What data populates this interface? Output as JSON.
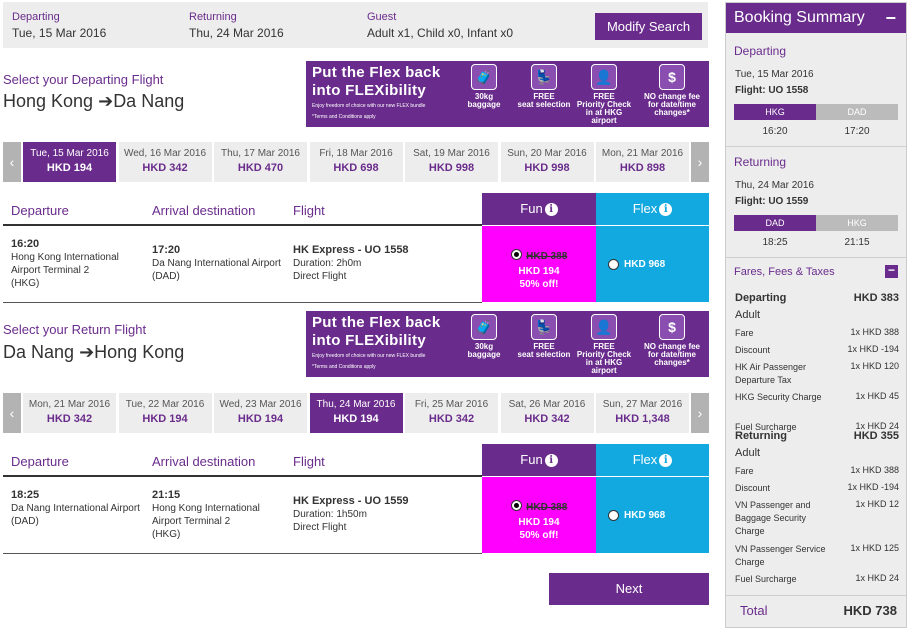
{
  "search": {
    "departing_label": "Departing",
    "departing_value": "Tue, 15 Mar 2016",
    "returning_label": "Returning",
    "returning_value": "Thu, 24 Mar 2016",
    "guest_label": "Guest",
    "guest_value": "Adult x1, Child x0, Infant x0",
    "modify_label": "Modify Search"
  },
  "banner": {
    "title_line1": "Put the Flex back",
    "title_line2": "into FLEXibility",
    "subtitle": "Enjoy freedom of choice with our new FLEX bundle",
    "terms": "*Terms and Conditions apply",
    "features": [
      {
        "icon": "baggage-icon",
        "glyph": "🧳",
        "line1": "30kg",
        "line2": "baggage"
      },
      {
        "icon": "seat-icon",
        "glyph": "💺",
        "line1": "FREE",
        "line2": "seat selection"
      },
      {
        "icon": "check-in-icon",
        "glyph": "👤",
        "line1": "FREE",
        "line2": "Priority Check in at HKG airport"
      },
      {
        "icon": "no-fee-icon",
        "glyph": "$",
        "line1": "NO change fee",
        "line2": "for date/time changes*"
      }
    ]
  },
  "outbound": {
    "select_title": "Select your Departing Flight",
    "route_from": "Hong Kong",
    "route_to": "Da Nang",
    "dates": [
      {
        "date": "Tue, 15 Mar 2016",
        "price": "HKD 194",
        "selected": true
      },
      {
        "date": "Wed, 16 Mar 2016",
        "price": "HKD 342",
        "selected": false
      },
      {
        "date": "Thu, 17 Mar 2016",
        "price": "HKD 470",
        "selected": false
      },
      {
        "date": "Fri, 18 Mar 2016",
        "price": "HKD 698",
        "selected": false
      },
      {
        "date": "Sat, 19 Mar 2016",
        "price": "HKD 998",
        "selected": false
      },
      {
        "date": "Sun, 20 Mar 2016",
        "price": "HKD 998",
        "selected": false
      },
      {
        "date": "Mon, 21 Mar 2016",
        "price": "HKD 898",
        "selected": false
      }
    ],
    "flight": {
      "dep_time": "16:20",
      "dep_airport": "Hong Kong International Airport Terminal 2",
      "dep_code": "(HKG)",
      "arr_time": "17:20",
      "arr_airport": "Da Nang International Airport",
      "arr_code": "(DAD)",
      "flight_no": "HK Express - UO 1558",
      "duration": "Duration: 2h0m",
      "type": "Direct Flight",
      "fun_old_price": "HKD 388",
      "fun_price": "HKD 194",
      "fun_discount": "50% off!",
      "flex_price": "HKD 968"
    }
  },
  "inbound": {
    "select_title": "Select your Return Flight",
    "route_from": "Da Nang",
    "route_to": "Hong Kong",
    "dates": [
      {
        "date": "Mon, 21 Mar 2016",
        "price": "HKD 342",
        "selected": false
      },
      {
        "date": "Tue, 22 Mar 2016",
        "price": "HKD 194",
        "selected": false
      },
      {
        "date": "Wed, 23 Mar 2016",
        "price": "HKD 194",
        "selected": false
      },
      {
        "date": "Thu, 24 Mar 2016",
        "price": "HKD 194",
        "selected": true
      },
      {
        "date": "Fri, 25 Mar 2016",
        "price": "HKD 342",
        "selected": false
      },
      {
        "date": "Sat, 26 Mar 2016",
        "price": "HKD 342",
        "selected": false
      },
      {
        "date": "Sun, 27 Mar 2016",
        "price": "HKD 1,348",
        "selected": false
      }
    ],
    "flight": {
      "dep_time": "18:25",
      "dep_airport": "Da Nang International Airport",
      "dep_code": "(DAD)",
      "arr_time": "21:15",
      "arr_airport": "Hong Kong International Airport Terminal 2",
      "arr_code": "(HKG)",
      "flight_no": "HK Express - UO 1559",
      "duration": "Duration: 1h50m",
      "type": "Direct Flight",
      "fun_old_price": "HKD 388",
      "fun_price": "HKD 194",
      "fun_discount": "50% off!",
      "flex_price": "HKD 968"
    }
  },
  "table_headers": {
    "departure": "Departure",
    "arrival": "Arrival destination",
    "flight": "Flight",
    "fun": "Fun",
    "flex": "Flex"
  },
  "next_label": "Next",
  "summary": {
    "title": "Booking Summary",
    "collapse": "−",
    "departing": {
      "label": "Departing",
      "date": "Tue, 15 Mar 2016",
      "flight": "Flight: UO 1558",
      "from": "HKG",
      "to": "DAD",
      "dep_time": "16:20",
      "arr_time": "17:20"
    },
    "returning": {
      "label": "Returning",
      "date": "Thu, 24 Mar 2016",
      "flight": "Flight: UO 1559",
      "from": "DAD",
      "to": "HKG",
      "dep_time": "18:25",
      "arr_time": "21:15"
    },
    "fees_title": "Fares, Fees & Taxes",
    "fees_toggle": "−",
    "dep_fees": {
      "label": "Departing",
      "amount": "HKD 383",
      "pax": "Adult",
      "items": [
        {
          "label": "Fare",
          "amount": "1x HKD 388"
        },
        {
          "label": "Discount",
          "amount": "1x HKD -194"
        },
        {
          "label": "HK Air Passenger Departure Tax",
          "amount": "1x HKD 120"
        },
        {
          "label": "HKG Security Charge",
          "amount": "1x HKD 45"
        },
        {
          "label": "Fuel Surcharge",
          "amount": "1x HKD 24"
        }
      ]
    },
    "ret_fees": {
      "label": "Returning",
      "amount": "HKD 355",
      "pax": "Adult",
      "items": [
        {
          "label": "Fare",
          "amount": "1x HKD 388"
        },
        {
          "label": "Discount",
          "amount": "1x HKD -194"
        },
        {
          "label": "VN Passenger and Baggage Security Charge",
          "amount": "1x HKD 12"
        },
        {
          "label": "VN Passenger Service Charge",
          "amount": "1x HKD 125"
        },
        {
          "label": "Fuel Surcharge",
          "amount": "1x HKD 24"
        }
      ]
    },
    "total_label": "Total",
    "total_amount": "HKD 738"
  },
  "colors": {
    "brand_purple": "#6a2c8c",
    "fun_magenta": "#ff00ff",
    "flex_blue": "#12a8e0"
  }
}
